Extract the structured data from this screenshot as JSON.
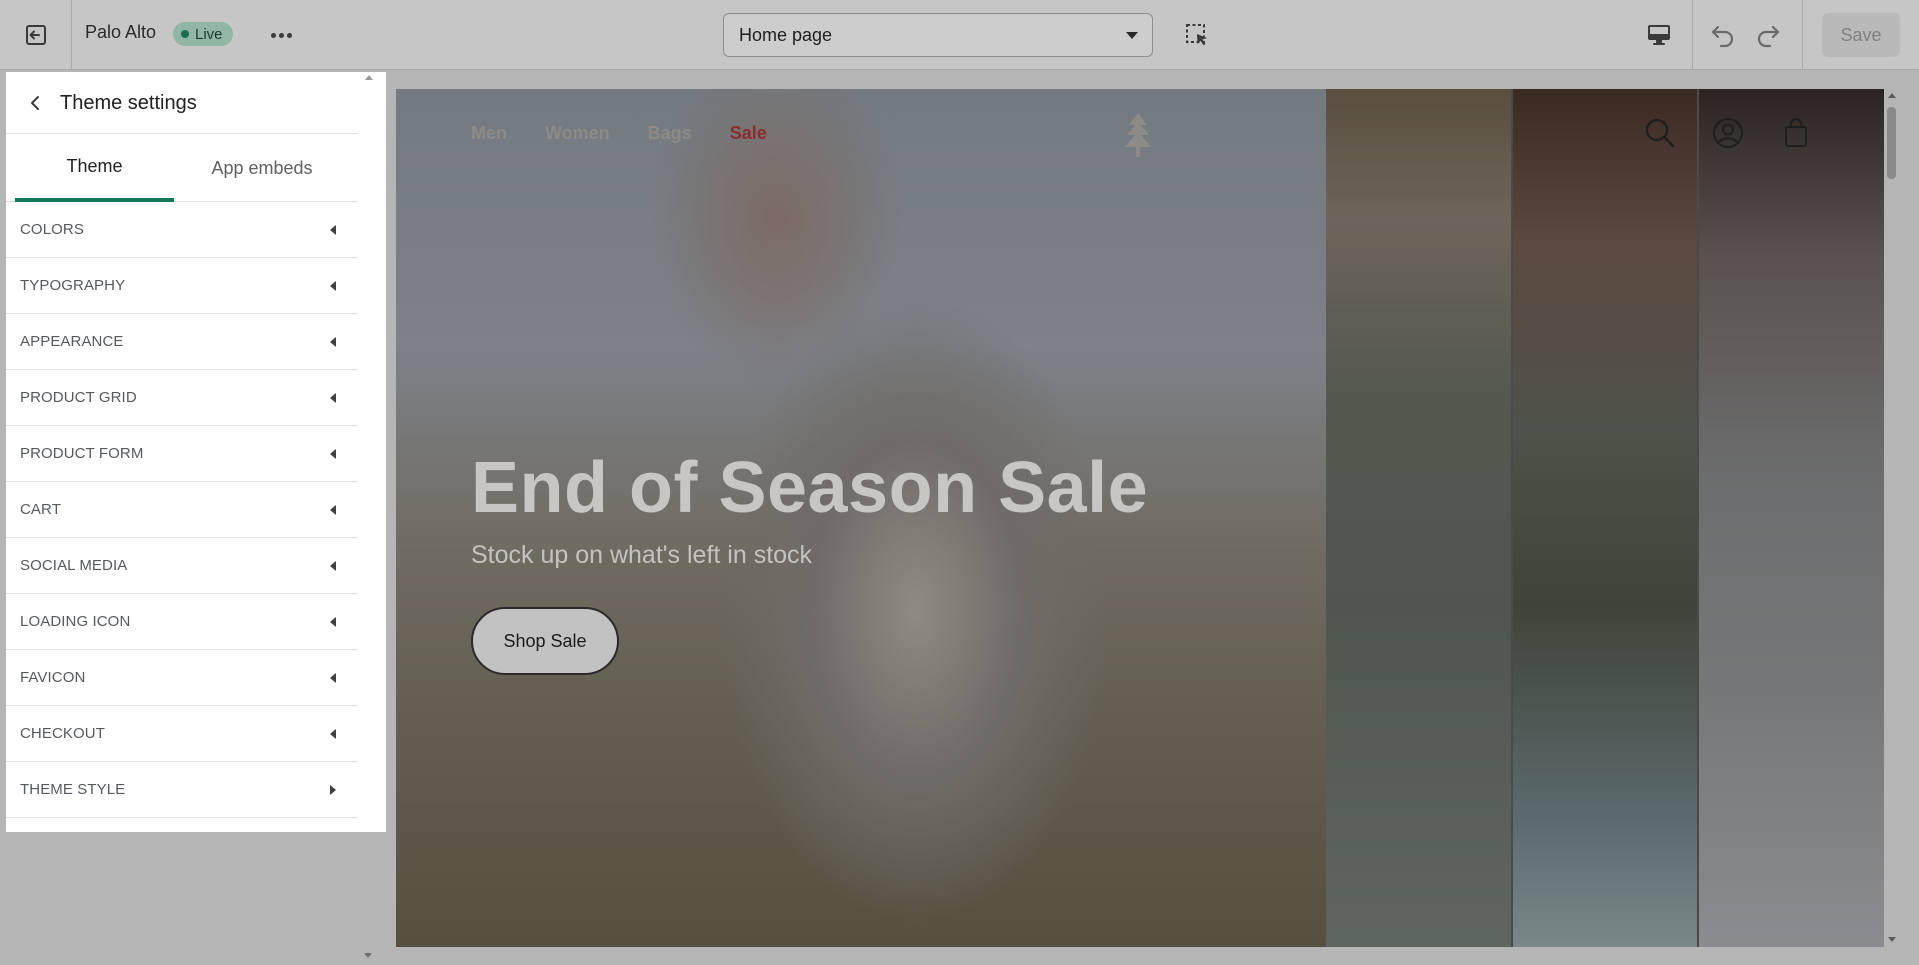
{
  "topbar": {
    "store_name": "Palo Alto",
    "status_badge": "Live",
    "page_selector": "Home page",
    "save_label": "Save"
  },
  "icons": {
    "exit": "exit-icon",
    "more": "more-horizontal-icon",
    "inspector": "select-inspector-icon",
    "device": "desktop-icon",
    "undo": "undo-icon",
    "redo": "redo-icon",
    "back": "arrow-left-icon",
    "search": "search-icon",
    "account": "account-icon",
    "cart": "shopping-bag-icon",
    "logo": "tree-logo-icon"
  },
  "sidebar": {
    "title": "Theme settings",
    "tabs": [
      {
        "label": "Theme",
        "active": true
      },
      {
        "label": "App embeds",
        "active": false
      }
    ],
    "items": [
      {
        "label": "COLORS",
        "expanded": false
      },
      {
        "label": "TYPOGRAPHY",
        "expanded": false
      },
      {
        "label": "APPEARANCE",
        "expanded": false
      },
      {
        "label": "PRODUCT GRID",
        "expanded": false
      },
      {
        "label": "PRODUCT FORM",
        "expanded": false
      },
      {
        "label": "CART",
        "expanded": false
      },
      {
        "label": "SOCIAL MEDIA",
        "expanded": false
      },
      {
        "label": "LOADING ICON",
        "expanded": false
      },
      {
        "label": "FAVICON",
        "expanded": false
      },
      {
        "label": "CHECKOUT",
        "expanded": false
      },
      {
        "label": "THEME STYLE",
        "expanded": true
      }
    ]
  },
  "preview": {
    "nav": [
      "Men",
      "Women",
      "Bags",
      "Sale"
    ],
    "hero_title": "End of Season Sale",
    "hero_subtitle": "Stock up on what's left in stock",
    "hero_button": "Shop Sale"
  },
  "colors": {
    "accent": "#127a5a",
    "live_badge": "#8fb7a4",
    "sale_link": "#8a2d2d"
  }
}
